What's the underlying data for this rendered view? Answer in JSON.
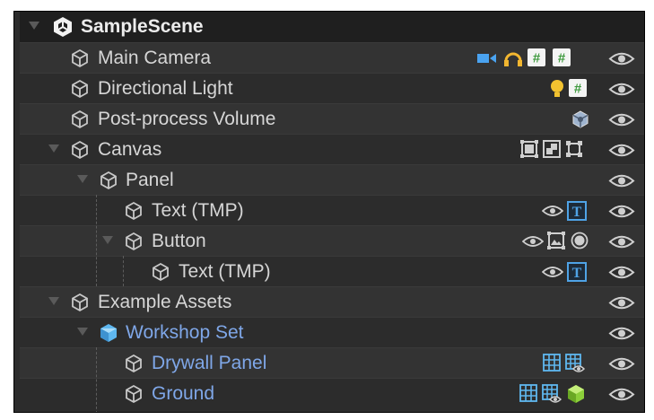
{
  "hierarchy": {
    "scene": {
      "label": "SampleScene"
    },
    "rows": [
      {
        "label": "Main Camera",
        "components": [
          "camera-icon",
          "audio-listener-icon",
          "script-icon",
          "script-icon"
        ]
      },
      {
        "label": "Directional Light",
        "components": [
          "light-bulb-icon",
          "script-icon"
        ]
      },
      {
        "label": "Post-process Volume",
        "components": [
          "post-process-icon"
        ]
      },
      {
        "label": "Canvas",
        "components": [
          "canvas-icon",
          "canvas-scaler-icon",
          "graphic-raycaster-icon"
        ]
      },
      {
        "label": "Panel",
        "components": []
      },
      {
        "label": "Text (TMP)",
        "components": [
          "visibility-icon",
          "textmeshpro-icon"
        ]
      },
      {
        "label": "Button",
        "components": [
          "visibility-icon",
          "image-icon",
          "button-icon"
        ]
      },
      {
        "label": "Text (TMP)",
        "components": [
          "visibility-icon",
          "textmeshpro-icon"
        ]
      },
      {
        "label": "Example Assets",
        "components": []
      },
      {
        "label": "Workshop Set",
        "components": []
      },
      {
        "label": "Drywall Panel",
        "components": [
          "mesh-filter-icon",
          "mesh-renderer-icon"
        ]
      },
      {
        "label": "Ground",
        "components": [
          "mesh-filter-icon",
          "mesh-renderer-icon",
          "collider-icon"
        ]
      }
    ]
  },
  "colors": {
    "prefab_text": "#7fa7e8",
    "normal_text": "#d6d6d6",
    "camera": "#4aa3f0",
    "light": "#f2c230",
    "script": "#7cc36a",
    "tmp": "#4fa3e6",
    "collider": "#8ccf3a"
  }
}
